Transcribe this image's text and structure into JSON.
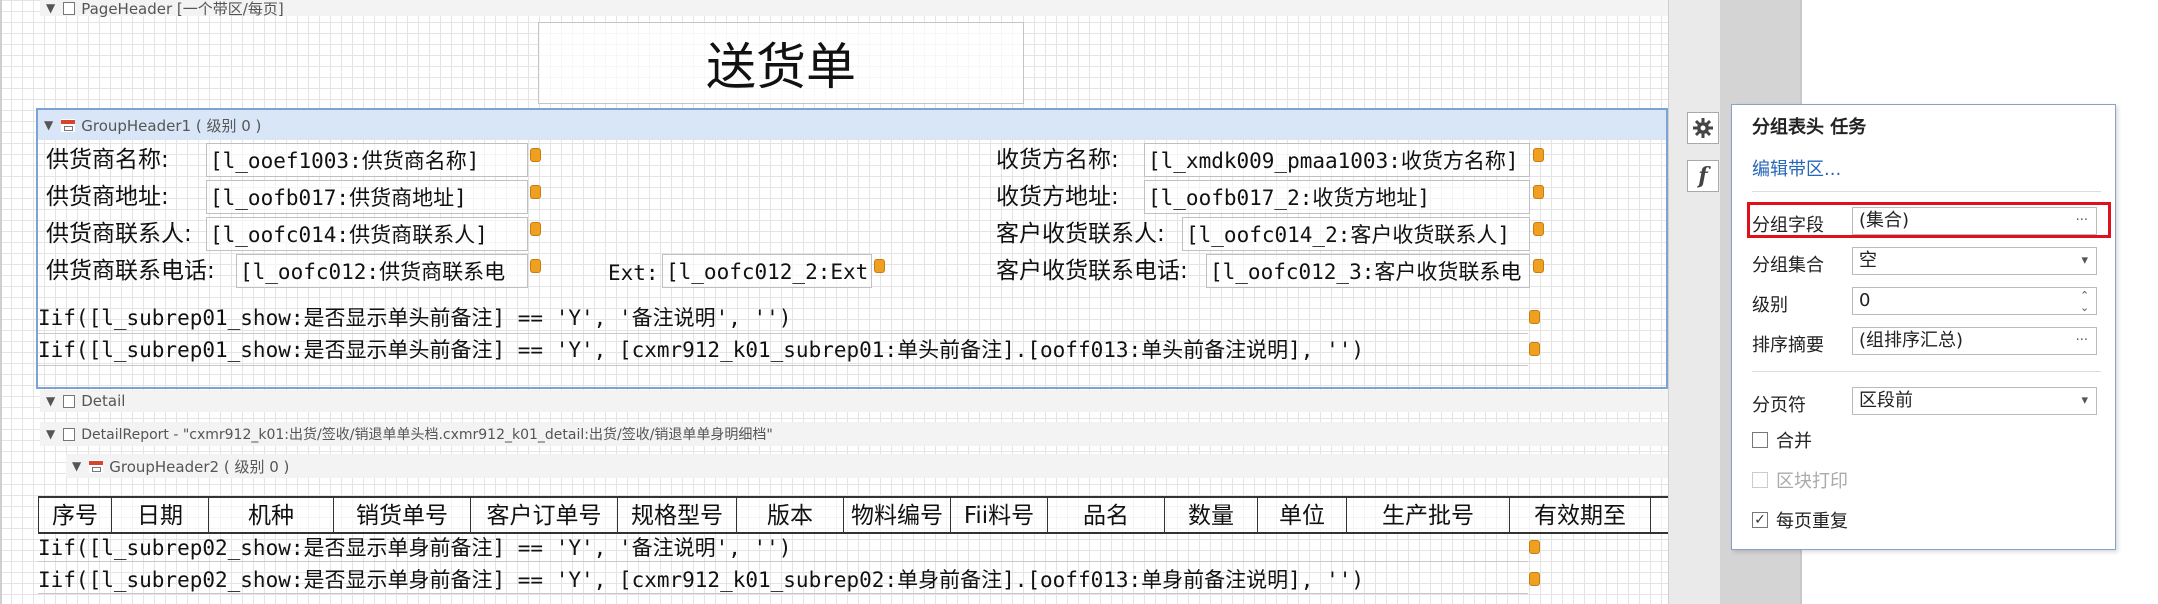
{
  "bands": {
    "page_header": "PageHeader [一个带区/每页]",
    "group_header1": "GroupHeader1 ( 级别 0 )",
    "detail": "Detail",
    "detail_report": "DetailReport - \"cxmr912_k01:出货/签收/销退单单头档.cxmr912_k01_detail:出货/签收/销退单单身明细档\"",
    "group_header2": "GroupHeader2 ( 级别 0 )"
  },
  "report_title": "送货单",
  "supplier": {
    "name_label": "供货商名称:",
    "name_field": "[l_ooef1003:供货商名称]",
    "addr_label": "供货商地址:",
    "addr_field": "[l_oofb017:供货商地址]",
    "contact_label": "供货商联系人:",
    "contact_field": "[l_oofc014:供货商联系人]",
    "phone_label": "供货商联系电话:",
    "phone_field": "[l_oofc012:供货商联系电",
    "ext_label": "Ext:",
    "ext_field": "[l_oofc012_2:Ext]"
  },
  "receiver": {
    "name_label": "收货方名称:",
    "name_field": "[l_xmdk009_pmaa1003:收货方名称]",
    "addr_label": "收货方地址:",
    "addr_field": "[l_oofb017_2:收货方地址]",
    "contact_label": "客户收货联系人:",
    "contact_field": "[l_oofc014_2:客户收货联系人]",
    "phone_label": "客户收货联系电话:",
    "phone_field": "[l_oofc012_3:客户收货联系电"
  },
  "header_exprs": [
    "Iif([l_subrep01_show:是否显示单头前备注] == 'Y', '备注说明', '')",
    "Iif([l_subrep01_show:是否显示单头前备注] == 'Y', [cxmr912_k01_subrep01:单头前备注].[ooff013:单头前备注说明], '')"
  ],
  "columns": [
    "序号",
    "日期",
    "机种",
    "销货单号",
    "客户订单号",
    "规格型号",
    "版本",
    "物料编号",
    "Fii料号",
    "品名",
    "数量",
    "单位",
    "生产批号",
    "有效期至"
  ],
  "detail_exprs": [
    "Iif([l_subrep02_show:是否显示单身前备注] == 'Y', '备注说明', '')",
    "Iif([l_subrep02_show:是否显示单身前备注] == 'Y', [cxmr912_k01_subrep02:单身前备注].[ooff013:单身前备注说明], '')"
  ],
  "side_buttons": {
    "gear_icon": "gear-icon",
    "formula": "f"
  },
  "tasks_panel": {
    "title": "分组表头 任务",
    "edit_link": "编辑带区...",
    "group_field_label": "分组字段",
    "group_field_value": "(集合)",
    "group_set_label": "分组集合",
    "group_set_value": "空",
    "level_label": "级别",
    "level_value": "0",
    "sort_summary_label": "排序摘要",
    "sort_summary_value": "(组排序汇总)",
    "page_break_label": "分页符",
    "page_break_value": "区段前",
    "merge_label": "合并",
    "block_print_label": "区块打印",
    "repeat_label": "每页重复",
    "ellipsis": "···",
    "dropdown_arrow": "▾",
    "spin": "⌃⌄"
  },
  "colors": {
    "highlight": "#e0111a",
    "link": "#2767b8",
    "field_tag": "#f0a020",
    "selected_band": "#d9e6f7"
  }
}
